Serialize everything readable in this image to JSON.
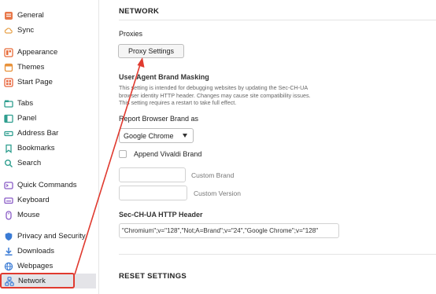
{
  "sidebar": {
    "items": [
      {
        "label": "General",
        "icon": "general-icon",
        "color": "#e8784a"
      },
      {
        "label": "Sync",
        "icon": "cloud-icon",
        "color": "#e8a24a"
      },
      {
        "label": "Appearance",
        "icon": "appearance-icon",
        "color": "#e86c3a"
      },
      {
        "label": "Themes",
        "icon": "themes-icon",
        "color": "#e8923a"
      },
      {
        "label": "Start Page",
        "icon": "start-page-icon",
        "color": "#e8643a"
      },
      {
        "label": "Tabs",
        "icon": "tabs-icon",
        "color": "#2f9e8f"
      },
      {
        "label": "Panel",
        "icon": "panel-icon",
        "color": "#2f9e8f"
      },
      {
        "label": "Address Bar",
        "icon": "address-bar-icon",
        "color": "#2f9e8f"
      },
      {
        "label": "Bookmarks",
        "icon": "bookmark-icon",
        "color": "#2f9e8f"
      },
      {
        "label": "Search",
        "icon": "search-icon",
        "color": "#2f9e8f"
      },
      {
        "label": "Quick Commands",
        "icon": "quick-commands-icon",
        "color": "#8a5cc6"
      },
      {
        "label": "Keyboard",
        "icon": "keyboard-icon",
        "color": "#8a5cc6"
      },
      {
        "label": "Mouse",
        "icon": "mouse-icon",
        "color": "#8a5cc6"
      },
      {
        "label": "Privacy and Security",
        "icon": "shield-icon",
        "color": "#3a7bd5"
      },
      {
        "label": "Downloads",
        "icon": "download-icon",
        "color": "#3a7bd5"
      },
      {
        "label": "Webpages",
        "icon": "globe-icon",
        "color": "#3a7bd5"
      },
      {
        "label": "Network",
        "icon": "network-icon",
        "color": "#3a7bd5"
      }
    ],
    "active": "Network"
  },
  "main": {
    "section_title": "NETWORK",
    "proxies": {
      "heading": "Proxies",
      "button_label": "Proxy Settings"
    },
    "ua": {
      "heading": "User Agent Brand Masking",
      "description": "This setting is intended for debugging websites by updating the Sec-CH-UA browser identity HTTP header. Changes may cause site compatibility issues. This setting requires a restart to take full effect.",
      "report_label": "Report Browser Brand as",
      "select_value": "Google Chrome",
      "append_label": "Append Vivaldi Brand",
      "append_checked": false,
      "custom_brand_label": "Custom Brand",
      "custom_brand_value": "",
      "custom_version_label": "Custom Version",
      "custom_version_value": "",
      "header_label": "Sec-CH-UA HTTP Header",
      "header_value": "\"Chromium\";v=\"128\",\"Not;A=Brand\";v=\"24\",\"Google Chrome\";v=\"128\""
    },
    "reset_title": "RESET SETTINGS"
  },
  "colors": {
    "annotation": "#e03a2f",
    "active_bg": "#e4e4e8"
  }
}
